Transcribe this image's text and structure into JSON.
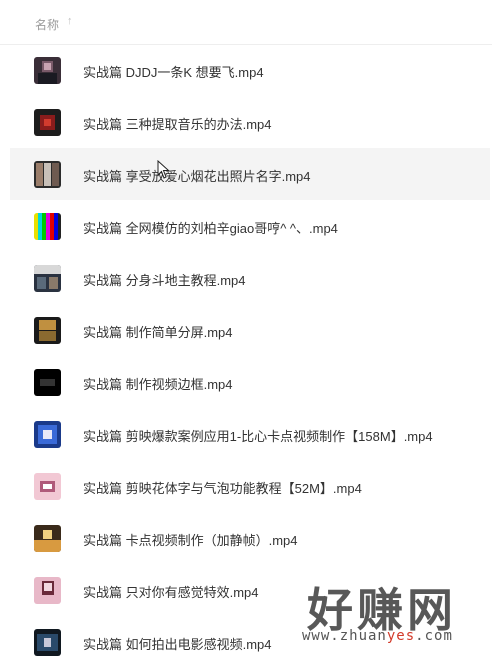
{
  "header": {
    "column_name": "名称",
    "sort_icon": "sort-ascending-icon"
  },
  "files": [
    {
      "name": "实战篇 DJDJ一条K 想要飞.mp4",
      "thumb": "portrait-dark"
    },
    {
      "name": "实战篇 三种提取音乐的办法.mp4",
      "thumb": "dark-red"
    },
    {
      "name": "实战篇 享受放爱心烟花出照片名字.mp4",
      "thumb": "photo-grid",
      "hover": true
    },
    {
      "name": "实战篇 全网模仿的刘柏辛giao哥哼^ ^、.mp4",
      "thumb": "color-bars"
    },
    {
      "name": "实战篇 分身斗地主教程.mp4",
      "thumb": "room-scene"
    },
    {
      "name": "实战篇 制作简单分屏.mp4",
      "thumb": "split-screen"
    },
    {
      "name": "实战篇 制作视频边框.mp4",
      "thumb": "black-frame"
    },
    {
      "name": "实战篇 剪映爆款案例应用1-比心卡点视频制作【158M】.mp4",
      "thumb": "blue-screen"
    },
    {
      "name": "实战篇 剪映花体字与气泡功能教程【52M】.mp4",
      "thumb": "pink-card"
    },
    {
      "name": "实战篇 卡点视频制作（加静帧）.mp4",
      "thumb": "warm-stage"
    },
    {
      "name": "实战篇 只对你有感觉特效.mp4",
      "thumb": "pink-portrait"
    },
    {
      "name": "实战篇 如何拍出电影感视频.mp4",
      "thumb": "dark-film"
    }
  ],
  "watermark": {
    "big": "好赚网",
    "small_prefix": "www.zhuan",
    "small_accent": "yes",
    "small_suffix": ".com"
  }
}
